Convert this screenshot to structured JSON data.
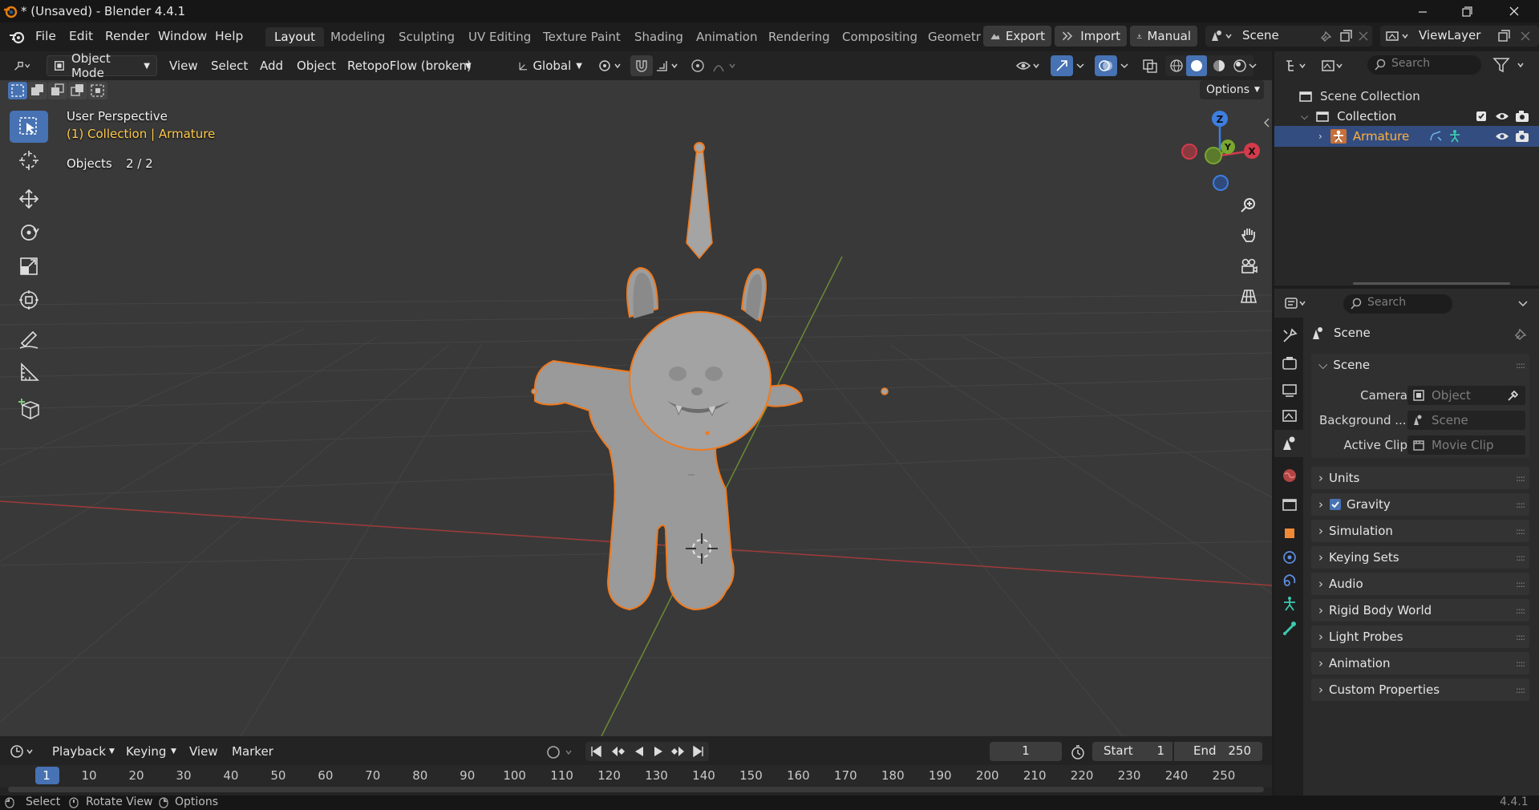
{
  "window": {
    "title": "* (Unsaved) - Blender 4.4.1",
    "version": "4.4.1"
  },
  "menubar": {
    "file": "File",
    "edit": "Edit",
    "render": "Render",
    "window": "Window",
    "help": "Help"
  },
  "workspaces": [
    "Layout",
    "Modeling",
    "Sculpting",
    "UV Editing",
    "Texture Paint",
    "Shading",
    "Animation",
    "Rendering",
    "Compositing",
    "Geometr"
  ],
  "addons": {
    "export": "Export",
    "import": "Import",
    "manual": "Manual"
  },
  "scene_selector": {
    "scene": "Scene",
    "view_layer": "ViewLayer"
  },
  "viewport_header": {
    "mode": "Object Mode",
    "view": "View",
    "select": "Select",
    "add": "Add",
    "object": "Object",
    "retopoflow": "RetopoFlow (broken)",
    "orientation": "Global",
    "options": "Options"
  },
  "viewport_overlay": {
    "view_name": "User Perspective",
    "collection": "(1) Collection",
    "separator": "|",
    "active_object": "Armature",
    "objects_label": "Objects",
    "objects_count": "2 / 2"
  },
  "gizmo": {
    "z": "Z",
    "y": "Y",
    "x": "X"
  },
  "outliner": {
    "search_placeholder": "Search",
    "scene_collection": "Scene Collection",
    "collection": "Collection",
    "armature": "Armature"
  },
  "properties": {
    "search_placeholder": "Search",
    "context": "Scene",
    "panel_scene": "Scene",
    "camera_label": "Camera",
    "camera_value": "Object",
    "background_label": "Background ...",
    "background_value": "Scene",
    "active_clip_label": "Active Clip",
    "active_clip_value": "Movie Clip",
    "sections": [
      "Units",
      "Gravity",
      "Simulation",
      "Keying Sets",
      "Audio",
      "Rigid Body World",
      "Light Probes",
      "Animation",
      "Custom Properties"
    ],
    "gravity_checked": true
  },
  "timeline": {
    "playback": "Playback",
    "keying": "Keying",
    "view": "View",
    "marker": "Marker",
    "current_frame": "1",
    "start_label": "Start",
    "start_value": "1",
    "end_label": "End",
    "end_value": "250",
    "ruler": [
      "1",
      "10",
      "20",
      "30",
      "40",
      "50",
      "60",
      "70",
      "80",
      "90",
      "100",
      "110",
      "120",
      "130",
      "140",
      "150",
      "160",
      "170",
      "180",
      "190",
      "200",
      "210",
      "220",
      "230",
      "240",
      "250"
    ]
  },
  "statusbar": {
    "select": "Select",
    "rotate": "Rotate View",
    "options": "Options"
  },
  "colors": {
    "accent": "#4772b3",
    "selection_outline": "#f07a1e",
    "active_text": "#ffc94a",
    "x_axis": "#d23b4b",
    "y_axis": "#7aa72e",
    "z_axis": "#3d7ee0"
  }
}
